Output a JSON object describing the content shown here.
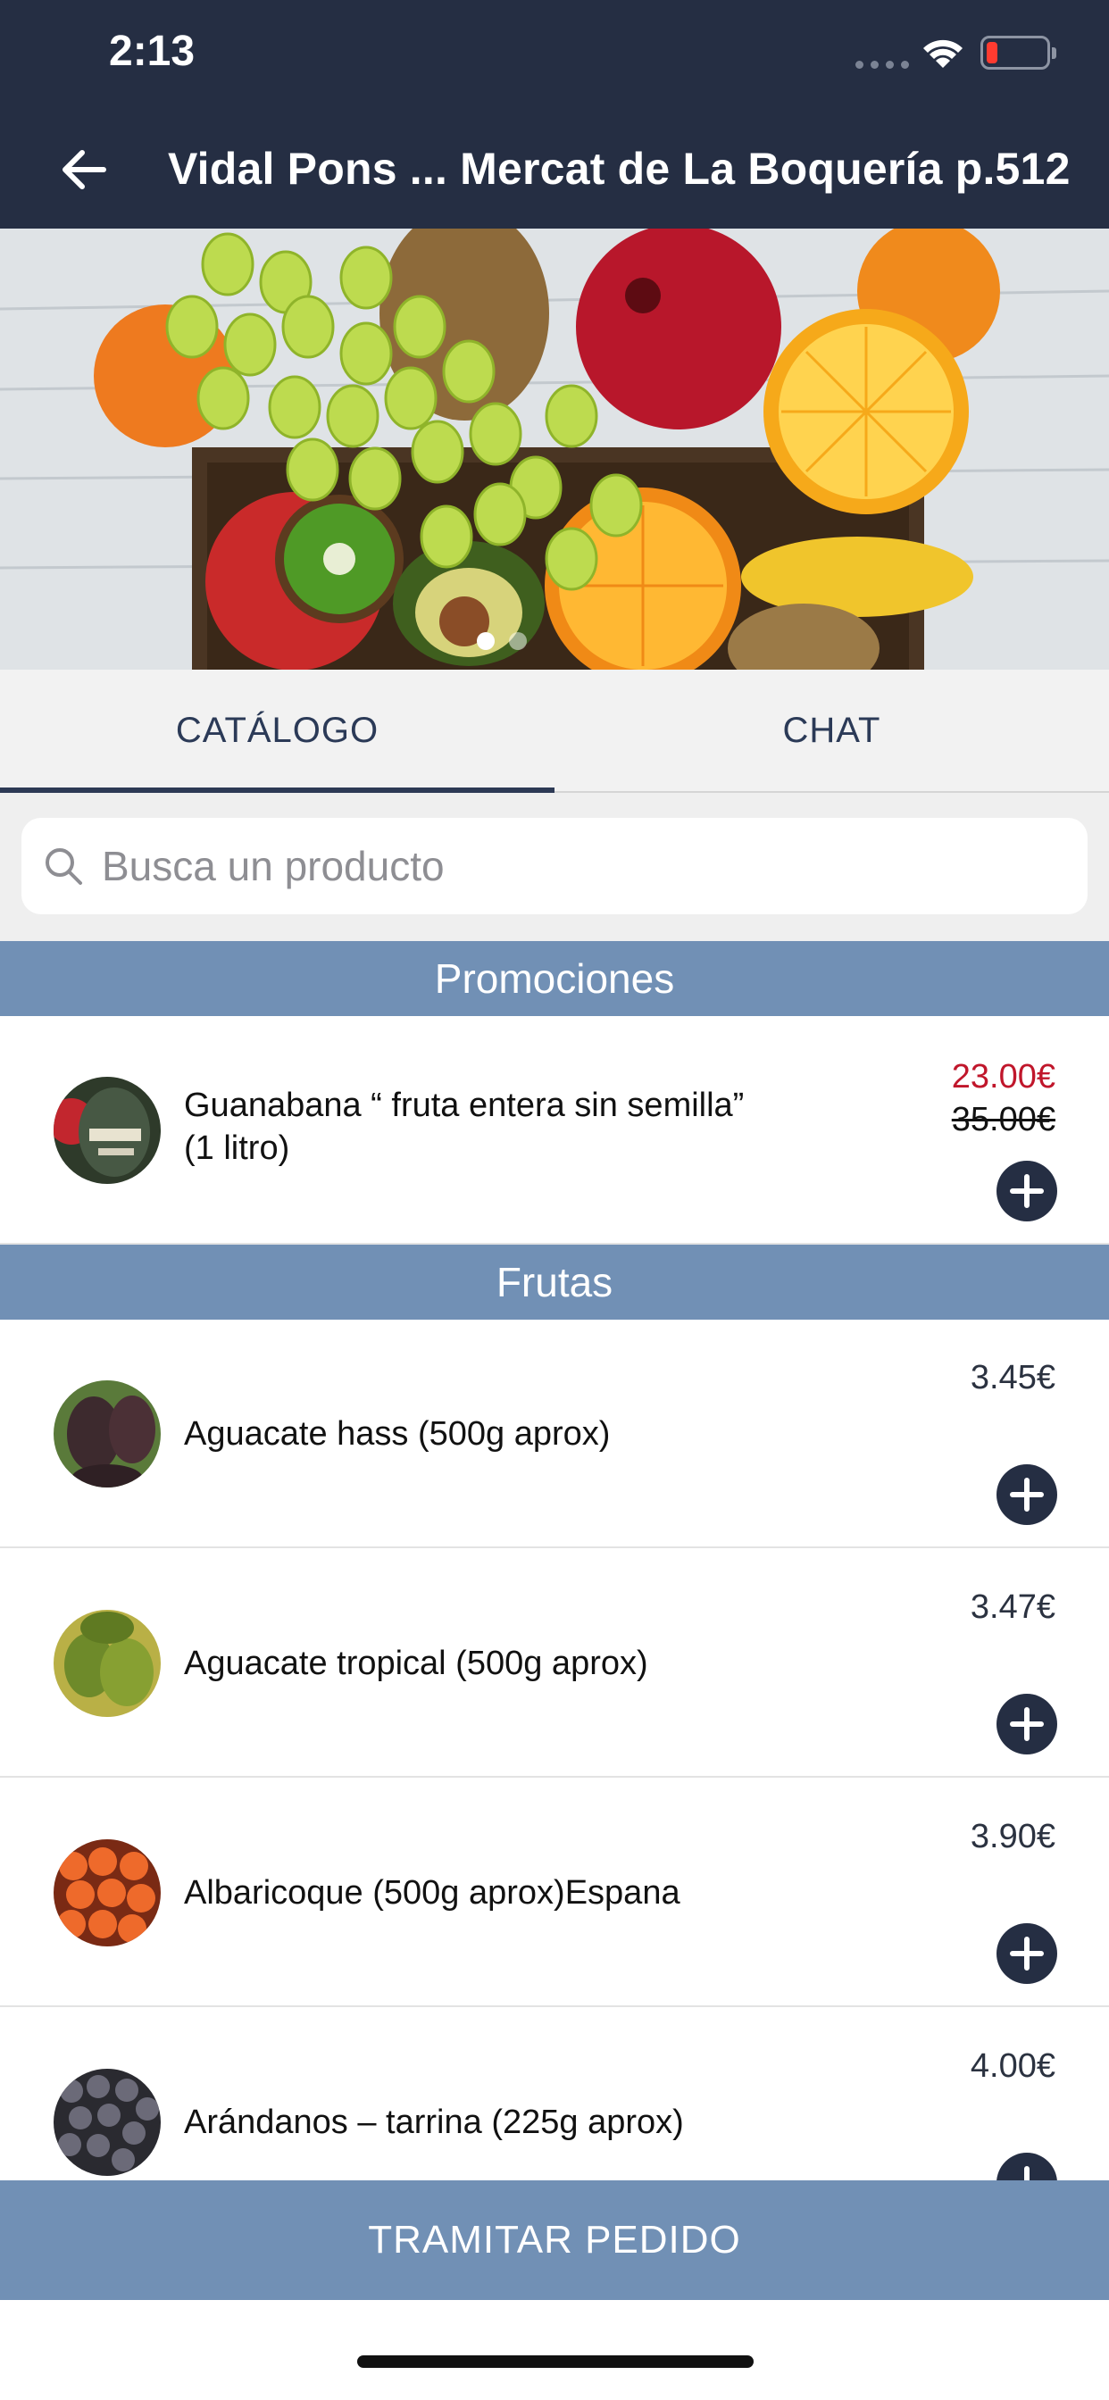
{
  "status_bar": {
    "time": "2:13"
  },
  "header": {
    "title": "Vidal Pons ... Mercat de La Boquería p.512"
  },
  "hero": {
    "slides": 2,
    "active_slide": 1
  },
  "tabs": [
    {
      "label": "CATÁLOGO",
      "active": true
    },
    {
      "label": "CHAT",
      "active": false
    }
  ],
  "search": {
    "placeholder": "Busca un producto",
    "value": ""
  },
  "sections": {
    "promos": {
      "title": "Promociones"
    },
    "fruits": {
      "title": "Frutas"
    }
  },
  "promo_items": [
    {
      "name": "Guanabana “ fruta entera sin semilla” (1 litro)",
      "price": "23.00€",
      "old_price": "35.00€",
      "thumb": "soursop-icon"
    }
  ],
  "fruit_items": [
    {
      "name": "Aguacate hass (500g aprox)",
      "price": "3.45€",
      "thumb": "avocado-hass-icon"
    },
    {
      "name": "Aguacate tropical (500g aprox)",
      "price": "3.47€",
      "thumb": "avocado-tropical-icon"
    },
    {
      "name": "Albaricoque (500g aprox)Espana",
      "price": "3.90€",
      "thumb": "apricot-icon"
    },
    {
      "name": "Arándanos – tarrina (225g aprox)",
      "price": "4.00€",
      "thumb": "blueberries-icon"
    }
  ],
  "checkout": {
    "label": "TRAMITAR PEDIDO"
  },
  "colors": {
    "header_bg": "#252e43",
    "section_bg": "#7190b5",
    "promo_price": "#c0162b",
    "accent": "#2d3a55"
  }
}
